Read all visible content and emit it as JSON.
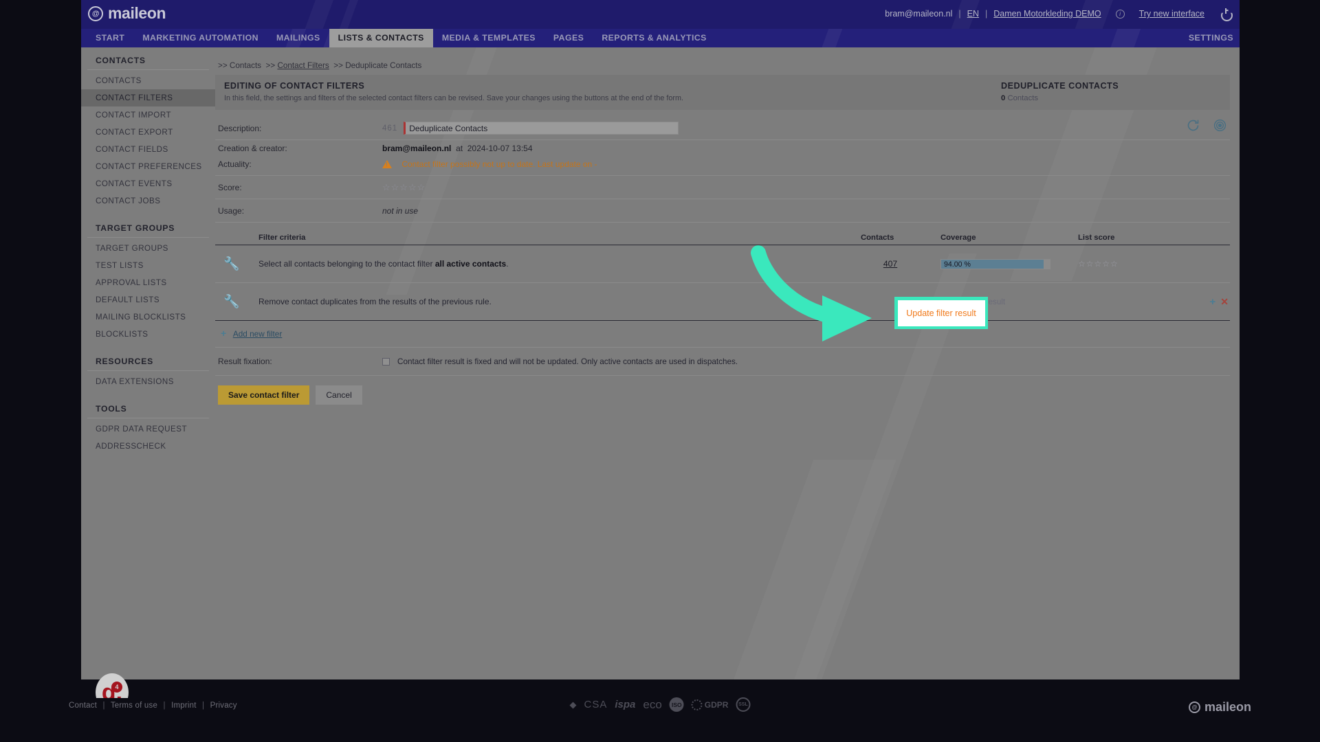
{
  "brand": {
    "name": "maileon",
    "footer_name": "maileon"
  },
  "topbar": {
    "user_email": "bram@maileon.nl",
    "sep": "|",
    "language": "EN",
    "account": "Damen Motorkleding DEMO",
    "info_icon": "info-icon",
    "try_new_interface": "Try new interface",
    "power_icon": "power-icon"
  },
  "nav": {
    "items": [
      {
        "label": "START",
        "active": false
      },
      {
        "label": "MARKETING AUTOMATION",
        "active": false
      },
      {
        "label": "MAILINGS",
        "active": false
      },
      {
        "label": "LISTS & CONTACTS",
        "active": true
      },
      {
        "label": "MEDIA & TEMPLATES",
        "active": false
      },
      {
        "label": "PAGES",
        "active": false
      },
      {
        "label": "REPORTS & ANALYTICS",
        "active": false
      }
    ],
    "settings": "SETTINGS"
  },
  "sidebar": {
    "groups": [
      {
        "title": "CONTACTS",
        "items": [
          {
            "label": "CONTACTS",
            "active": false
          },
          {
            "label": "CONTACT FILTERS",
            "active": true
          },
          {
            "label": "CONTACT IMPORT",
            "active": false
          },
          {
            "label": "CONTACT EXPORT",
            "active": false
          },
          {
            "label": "CONTACT FIELDS",
            "active": false
          },
          {
            "label": "CONTACT PREFERENCES",
            "active": false
          },
          {
            "label": "CONTACT EVENTS",
            "active": false
          },
          {
            "label": "CONTACT JOBS",
            "active": false
          }
        ]
      },
      {
        "title": "TARGET GROUPS",
        "items": [
          {
            "label": "TARGET GROUPS",
            "active": false
          },
          {
            "label": "TEST LISTS",
            "active": false
          },
          {
            "label": "APPROVAL LISTS",
            "active": false
          },
          {
            "label": "DEFAULT LISTS",
            "active": false
          },
          {
            "label": "MAILING BLOCKLISTS",
            "active": false
          },
          {
            "label": "BLOCKLISTS",
            "active": false
          }
        ]
      },
      {
        "title": "RESOURCES",
        "items": [
          {
            "label": "DATA EXTENSIONS",
            "active": false
          }
        ]
      },
      {
        "title": "TOOLS",
        "items": [
          {
            "label": "GDPR DATA REQUEST",
            "active": false
          },
          {
            "label": "ADDRESSCHECK",
            "active": false
          }
        ]
      }
    ]
  },
  "breadcrumb": {
    "prefix": ">>",
    "item1": "Contacts",
    "item2": "Contact Filters",
    "item3": "Deduplicate Contacts"
  },
  "panel": {
    "title": "EDITING OF CONTACT FILTERS",
    "subtitle": "In this field, the settings and filters of the selected contact filters can be revised. Save your changes using the buttons at the end of the form.",
    "right_title": "DEDUPLICATE CONTACTS",
    "right_count": "0",
    "right_count_label": "Contacts"
  },
  "form": {
    "description_label": "Description:",
    "description_charcount": "461",
    "description_value": "Deduplicate Contacts",
    "refresh_icon": "refresh-icon",
    "target_icon": "target-icon",
    "creation_label": "Creation & creator:",
    "creator": "bram@maileon.nl",
    "creation_at": "at",
    "creation_date": "2024-10-07 13:54",
    "actuality_label": "Actuality:",
    "actuality_warning": "Contact filter possibly not up to date. Last update on -",
    "score_label": "Score:",
    "score_stars": "☆☆☆☆☆",
    "usage_label": "Usage:",
    "usage_value": "not in use"
  },
  "filter_table": {
    "headers": {
      "criteria": "Filter criteria",
      "contacts": "Contacts",
      "coverage": "Coverage",
      "list_score": "List score"
    },
    "rows": [
      {
        "icon": "wrench-icon",
        "criteria_text": "Select all contacts belonging to the contact filter ",
        "criteria_bold": "all active contacts",
        "criteria_tail": ".",
        "contacts": "407",
        "coverage_text": "94.00 %",
        "coverage_percent": 94.0,
        "stars": "☆☆☆☆☆",
        "has_actions": false
      },
      {
        "icon": "wrench-icon",
        "criteria_text": "Remove contact duplicates from the results of the previous rule.",
        "criteria_bold": "",
        "criteria_tail": "",
        "contacts": "",
        "coverage_text": "",
        "coverage_percent": 0,
        "stars": "",
        "has_actions": true,
        "update_link": "Update filter result",
        "plus_icon": "plus-icon",
        "remove_icon": "remove-icon"
      }
    ]
  },
  "add_new_filter": {
    "icon": "plus-icon",
    "label": "Add new filter"
  },
  "result_fixation": {
    "label": "Result fixation:",
    "checkbox_label": "Contact filter result is fixed and will not be updated. Only active contacts are used in dispatches.",
    "checked": false
  },
  "buttons": {
    "save": "Save contact filter",
    "cancel": "Cancel"
  },
  "annotation": {
    "highlight_label": "Update filter result",
    "highlight_color": "#3ae8bd",
    "arrow_color": "#3ae8bd",
    "text_color": "#f07818"
  },
  "badge_g4": {
    "letter": "g.",
    "number": "4"
  },
  "footer": {
    "links": [
      "Contact",
      "Terms of use",
      "Imprint",
      "Privacy"
    ],
    "separator": "|",
    "badges": [
      "CSA",
      "ispa",
      "eco",
      "ISO",
      "GDPR",
      "SSL"
    ],
    "brand": "maileon"
  }
}
